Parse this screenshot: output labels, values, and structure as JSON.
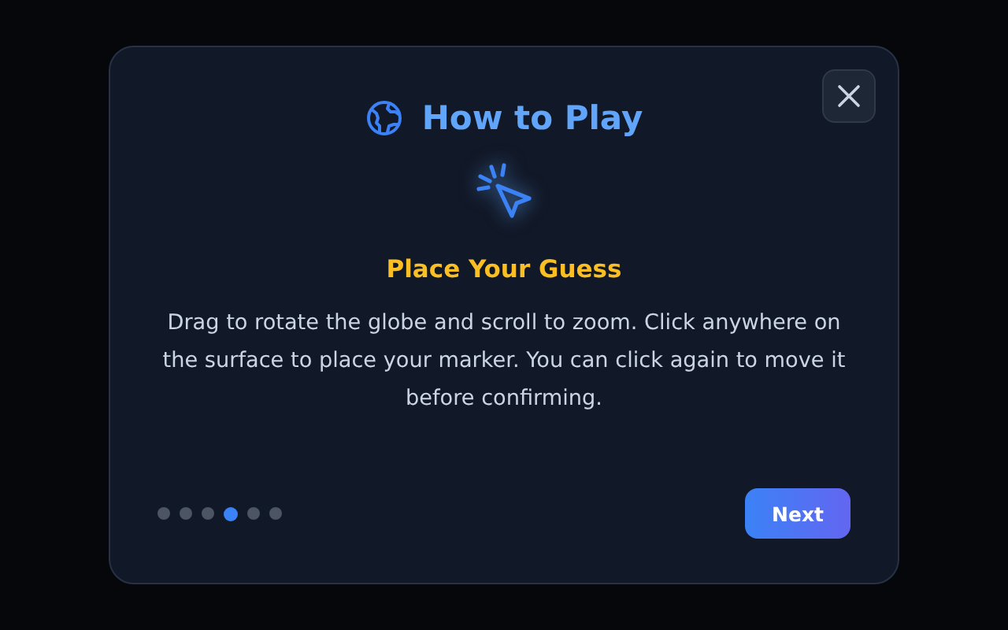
{
  "dialog": {
    "title": "How to Play",
    "step_title": "Place Your Guess",
    "step_text": "Drag to rotate the globe and scroll to zoom. Click anywhere on the surface to place your marker. You can click again to move it before confirming.",
    "steps": [
      {
        "selected": false
      },
      {
        "selected": false
      },
      {
        "selected": false
      },
      {
        "selected": true
      },
      {
        "selected": false
      },
      {
        "selected": false
      }
    ],
    "next_button": "Next"
  }
}
